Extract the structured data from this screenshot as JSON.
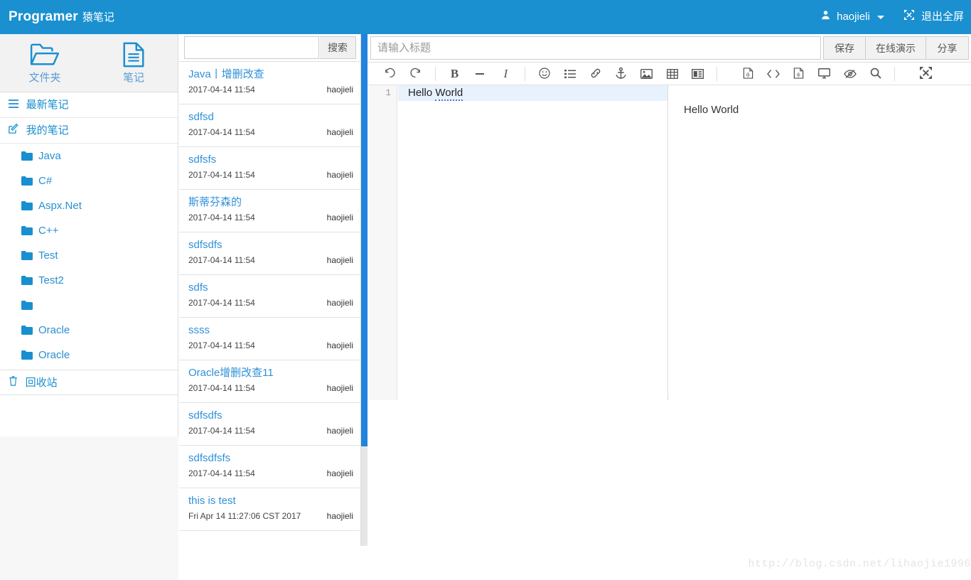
{
  "navbar": {
    "brand_en": "Programer",
    "brand_cn": "猿笔记",
    "user_icon": "user-icon",
    "user_name": "haojieli",
    "fullscreen_icon": "fullscreen-exit-icon",
    "fullscreen_label": "退出全屏",
    "background_color": "#1a90d0"
  },
  "sidebar": {
    "tabs": [
      {
        "icon": "open-folder-icon",
        "label": "文件夹"
      },
      {
        "icon": "document-icon",
        "label": "笔记"
      }
    ],
    "rows": [
      {
        "icon": "list-icon",
        "label": "最新笔记"
      },
      {
        "icon": "edit-pencil-icon",
        "label": "我的笔记"
      }
    ],
    "folders": [
      {
        "icon": "folder-icon",
        "label": "Java"
      },
      {
        "icon": "folder-icon",
        "label": "C#"
      },
      {
        "icon": "folder-icon",
        "label": "Aspx.Net"
      },
      {
        "icon": "folder-icon",
        "label": "C++"
      },
      {
        "icon": "folder-icon",
        "label": "Test"
      },
      {
        "icon": "folder-icon",
        "label": "Test2"
      },
      {
        "icon": "folder-icon",
        "label": ""
      },
      {
        "icon": "folder-icon",
        "label": "Oracle"
      },
      {
        "icon": "folder-icon",
        "label": "Oracle"
      }
    ],
    "trash": {
      "icon": "trash-icon",
      "label": "回收站"
    }
  },
  "notelist": {
    "search": {
      "value": "",
      "placeholder": "",
      "button_label": "搜索"
    },
    "items": [
      {
        "title": "Java丨增删改查",
        "date": "2017-04-14 11:54",
        "author": "haojieli"
      },
      {
        "title": "sdfsd",
        "date": "2017-04-14 11:54",
        "author": "haojieli"
      },
      {
        "title": "sdfsfs",
        "date": "2017-04-14 11:54",
        "author": "haojieli"
      },
      {
        "title": "斯蒂芬森的",
        "date": "2017-04-14 11:54",
        "author": "haojieli"
      },
      {
        "title": "sdfsdfs",
        "date": "2017-04-14 11:54",
        "author": "haojieli"
      },
      {
        "title": "sdfs",
        "date": "2017-04-14 11:54",
        "author": "haojieli"
      },
      {
        "title": "ssss",
        "date": "2017-04-14 11:54",
        "author": "haojieli"
      },
      {
        "title": "Oracle增删改查11",
        "date": "2017-04-14 11:54",
        "author": "haojieli"
      },
      {
        "title": "sdfsdfs",
        "date": "2017-04-14 11:54",
        "author": "haojieli"
      },
      {
        "title": "sdfsdfsfs",
        "date": "2017-04-14 11:54",
        "author": "haojieli"
      },
      {
        "title": "this is test",
        "date": "Fri Apr 14 11:27:06 CST 2017",
        "author": "haojieli"
      }
    ],
    "scrollbar_color": "#2083de"
  },
  "editor": {
    "title_input": {
      "value": "",
      "placeholder": "请输入标题"
    },
    "buttons": {
      "save_label": "保存",
      "preview_label": "在线演示",
      "share_label": "分享"
    },
    "toolbar_icons": [
      "undo-icon",
      "redo-icon",
      "bold-icon",
      "strikethrough-icon",
      "italic-icon",
      "emoji-icon",
      "unordered-list-icon",
      "link-icon",
      "anchor-icon",
      "image-icon",
      "table-icon",
      "page-break-icon",
      "html-entity-icon",
      "code-icon",
      "code-block-icon",
      "preview-monitor-icon",
      "watch-off-icon",
      "search-icon",
      "fullscreen-icon"
    ],
    "line_numbers": [
      "1"
    ],
    "code_lines": [
      "Hello World"
    ],
    "preview_text": "Hello World",
    "active_line_color": "#e8f2fd"
  },
  "watermark": {
    "text": "http://blog.csdn.net/lihaojie1996"
  }
}
